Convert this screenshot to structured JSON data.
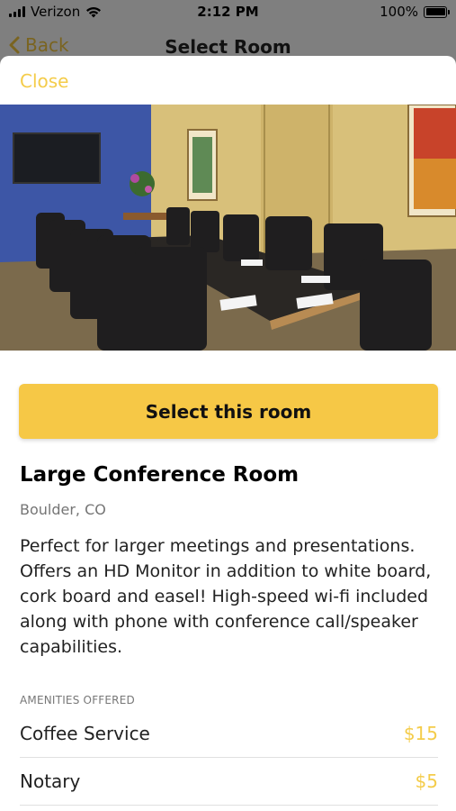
{
  "status_bar": {
    "carrier": "Verizon",
    "time": "2:12 PM",
    "battery": "100%"
  },
  "nav": {
    "back_label": "Back",
    "title": "Select Room"
  },
  "sheet": {
    "close_label": "Close",
    "select_button_label": "Select this room",
    "room_title": "Large Conference Room",
    "location": "Boulder, CO",
    "description": "Perfect for larger meetings and presentations. Offers an HD Monitor in addition to white board, cork board and easel! High-speed wi-fi included along with phone with conference call/speaker capabilities.",
    "amenities_header": "AMENITIES OFFERED",
    "amenities": [
      {
        "name": "Coffee Service",
        "price": "$15"
      },
      {
        "name": "Notary",
        "price": "$5"
      }
    ]
  },
  "colors": {
    "accent": "#f6c846",
    "accent_text": "#f4cc4a",
    "dim_overlay": "#7f7f7f"
  },
  "icons": {
    "back": "chevron-left-icon",
    "wifi": "wifi-icon",
    "signal": "signal-bars-icon",
    "battery": "battery-icon"
  }
}
